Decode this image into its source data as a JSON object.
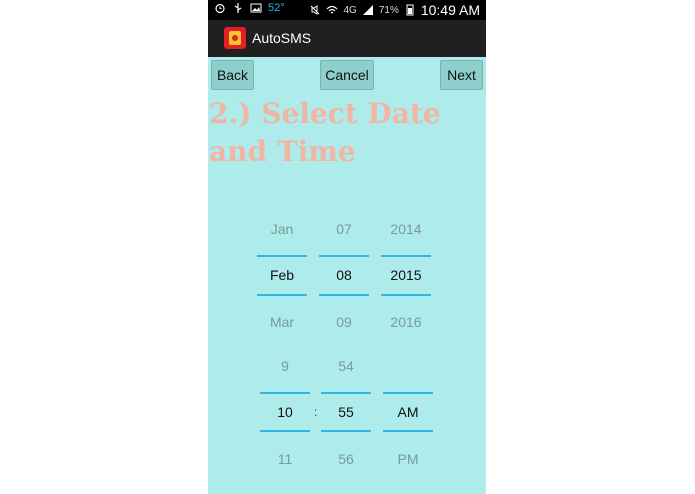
{
  "status_bar": {
    "temperature": "52°",
    "network": "4G",
    "battery": "71%",
    "time": "10:49 AM"
  },
  "app": {
    "title": "AutoSMS"
  },
  "buttons": {
    "back": "Back",
    "cancel": "Cancel",
    "next": "Next"
  },
  "heading": "2.) Select Date and Time",
  "date_picker": {
    "month": {
      "prev": "Jan",
      "current": "Feb",
      "next": "Mar"
    },
    "day": {
      "prev": "07",
      "current": "08",
      "next": "09"
    },
    "year": {
      "prev": "2014",
      "current": "2015",
      "next": "2016"
    }
  },
  "time_picker": {
    "hour": {
      "prev": "9",
      "current": "10",
      "next": "11"
    },
    "separator": ":",
    "minute": {
      "prev": "54",
      "current": "55",
      "next": "56"
    },
    "ampm": {
      "prev": "",
      "current": "AM",
      "next": "PM"
    }
  },
  "colors": {
    "background": "#aeebeb",
    "heading": "#f1b5a3",
    "picker_line": "#33b5e5",
    "button": "#8fcfcb"
  }
}
